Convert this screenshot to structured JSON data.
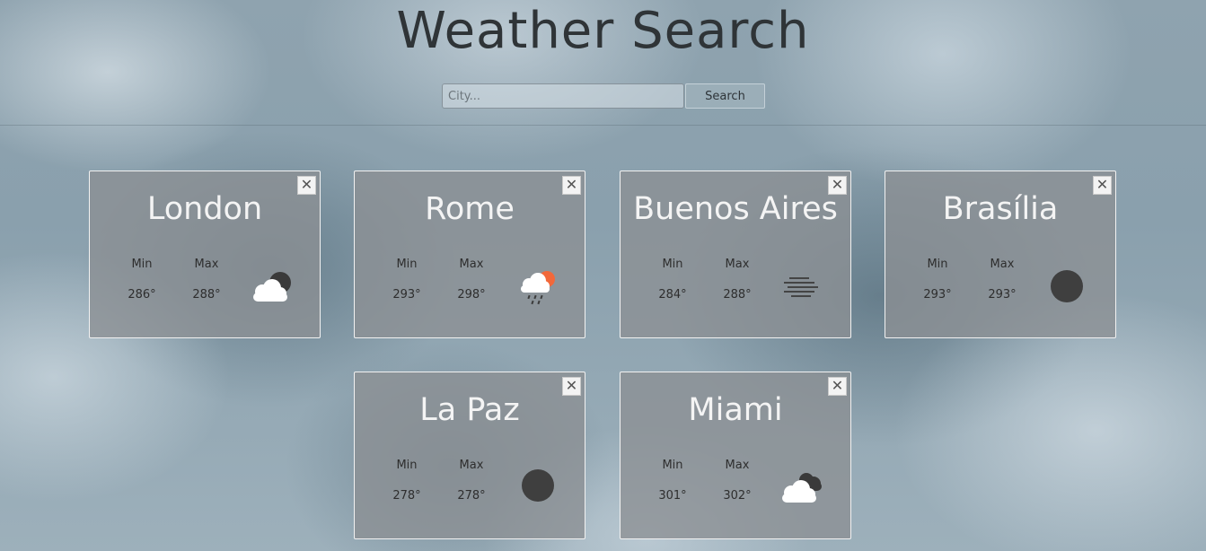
{
  "header": {
    "title": "Weather Search",
    "search_placeholder": "City...",
    "search_button": "Search"
  },
  "cards": [
    {
      "city": "London",
      "min_label": "Min",
      "max_label": "Max",
      "min": "286°",
      "max": "288°",
      "close": "✕",
      "icon": "cloud-moon-icon"
    },
    {
      "city": "Rome",
      "min_label": "Min",
      "max_label": "Max",
      "min": "293°",
      "max": "298°",
      "close": "✕",
      "icon": "rain-sun-icon"
    },
    {
      "city": "Buenos Aires",
      "min_label": "Min",
      "max_label": "Max",
      "min": "284°",
      "max": "288°",
      "close": "✕",
      "icon": "fog-icon"
    },
    {
      "city": "Brasília",
      "min_label": "Min",
      "max_label": "Max",
      "min": "293°",
      "max": "293°",
      "close": "✕",
      "icon": "moon-icon"
    },
    {
      "city": "La Paz",
      "min_label": "Min",
      "max_label": "Max",
      "min": "278°",
      "max": "278°",
      "close": "✕",
      "icon": "moon-icon"
    },
    {
      "city": "Miami",
      "min_label": "Min",
      "max_label": "Max",
      "min": "301°",
      "max": "302°",
      "close": "✕",
      "icon": "cloudy-icon"
    }
  ]
}
